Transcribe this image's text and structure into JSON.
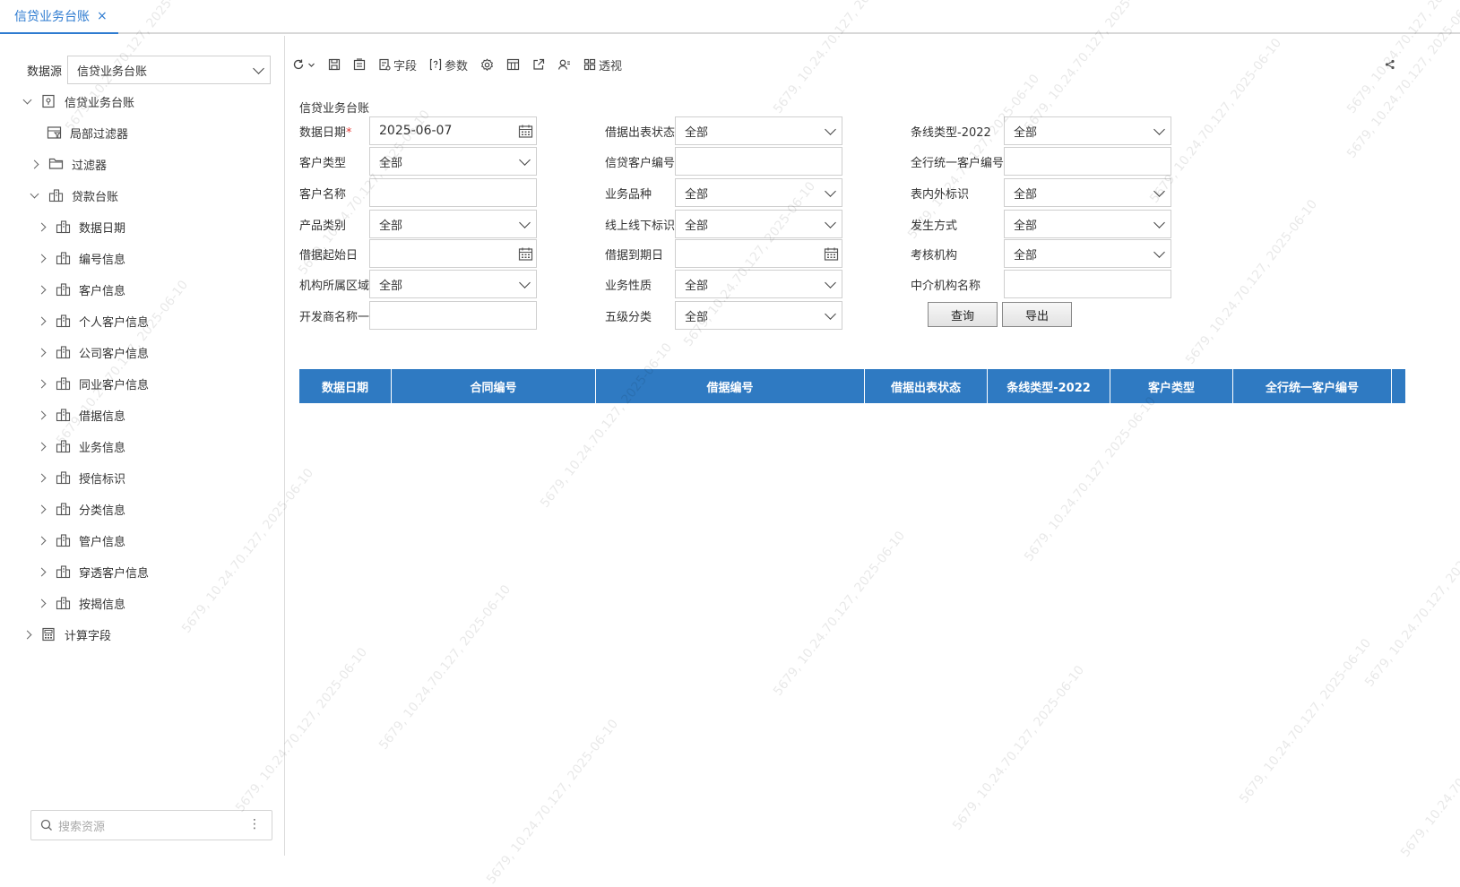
{
  "tab": {
    "title": "信贷业务台账",
    "close": "×"
  },
  "sidebar": {
    "datasource_label": "数据源",
    "datasource_value": "信贷业务台账",
    "tree": [
      {
        "label": "信贷业务台账",
        "level": 0,
        "caret": "down",
        "icon": "dataset-icon"
      },
      {
        "label": "局部过滤器",
        "level": 2,
        "caret": "none",
        "icon": "filter-table-icon"
      },
      {
        "label": "过滤器",
        "level": 1,
        "caret": "right",
        "icon": "folder-icon"
      },
      {
        "label": "贷款台账",
        "level": 1,
        "caret": "down",
        "icon": "table-group-icon"
      },
      {
        "label": "数据日期",
        "level": 2,
        "caret": "right",
        "icon": "table-group-icon"
      },
      {
        "label": "编号信息",
        "level": 2,
        "caret": "right",
        "icon": "table-group-icon"
      },
      {
        "label": "客户信息",
        "level": 2,
        "caret": "right",
        "icon": "table-group-icon"
      },
      {
        "label": "个人客户信息",
        "level": 2,
        "caret": "right",
        "icon": "table-group-icon"
      },
      {
        "label": "公司客户信息",
        "level": 2,
        "caret": "right",
        "icon": "table-group-icon"
      },
      {
        "label": "同业客户信息",
        "level": 2,
        "caret": "right",
        "icon": "table-group-icon"
      },
      {
        "label": "借据信息",
        "level": 2,
        "caret": "right",
        "icon": "table-group-icon"
      },
      {
        "label": "业务信息",
        "level": 2,
        "caret": "right",
        "icon": "table-group-icon"
      },
      {
        "label": "授信标识",
        "level": 2,
        "caret": "right",
        "icon": "table-group-icon"
      },
      {
        "label": "分类信息",
        "level": 2,
        "caret": "right",
        "icon": "table-group-icon"
      },
      {
        "label": "管户信息",
        "level": 2,
        "caret": "right",
        "icon": "table-group-icon"
      },
      {
        "label": "穿透客户信息",
        "level": 2,
        "caret": "right",
        "icon": "table-group-icon"
      },
      {
        "label": "按揭信息",
        "level": 2,
        "caret": "right",
        "icon": "table-group-icon"
      },
      {
        "label": "计算字段",
        "level": 0,
        "caret": "right",
        "icon": "calculator-icon"
      }
    ],
    "search_placeholder": "搜索资源",
    "search_more": "⋮"
  },
  "toolbar": {
    "field_label": "字段",
    "param_label": "参数",
    "pivot_label": "透视"
  },
  "report": {
    "title": "信贷业务台账",
    "fields": [
      {
        "label": "数据日期",
        "required": true,
        "type": "date",
        "value": "2025-06-07"
      },
      {
        "label": "借据出表状态",
        "type": "select",
        "value": "全部"
      },
      {
        "label": "条线类型-2022",
        "type": "select",
        "value": "全部"
      },
      {
        "label": "客户类型",
        "type": "select",
        "value": "全部"
      },
      {
        "label": "信贷客户编号",
        "type": "text",
        "value": ""
      },
      {
        "label": "全行统一客户编号",
        "type": "text",
        "value": ""
      },
      {
        "label": "客户名称",
        "type": "text",
        "value": ""
      },
      {
        "label": "业务品种",
        "type": "select",
        "value": "全部"
      },
      {
        "label": "表内外标识",
        "type": "select",
        "value": "全部"
      },
      {
        "label": "产品类别",
        "type": "select",
        "value": "全部"
      },
      {
        "label": "线上线下标识",
        "type": "select",
        "value": "全部"
      },
      {
        "label": "发生方式",
        "type": "select",
        "value": "全部"
      },
      {
        "label": "借据起始日",
        "type": "date",
        "value": ""
      },
      {
        "label": "借据到期日",
        "type": "date",
        "value": ""
      },
      {
        "label": "考核机构",
        "type": "select",
        "value": "全部"
      },
      {
        "label": "机构所属区域",
        "type": "select",
        "value": "全部"
      },
      {
        "label": "业务性质",
        "type": "select",
        "value": "全部"
      },
      {
        "label": "中介机构名称",
        "type": "text",
        "value": ""
      },
      {
        "label": "开发商名称一",
        "type": "text",
        "value": ""
      },
      {
        "label": "五级分类",
        "type": "select",
        "value": "全部"
      }
    ],
    "required_mark": "*",
    "query_button": "查询",
    "export_button": "导出",
    "columns": [
      "数据日期",
      "合同编号",
      "借据编号",
      "借据出表状态",
      "条线类型-2022",
      "客户类型",
      "全行统一客户编号"
    ]
  },
  "watermark_text": "5679, 10.24.70.127, 2025-06-10",
  "colors": {
    "accent": "#2e7bd0",
    "header": "#2f7ac2",
    "required": "#e53935"
  }
}
